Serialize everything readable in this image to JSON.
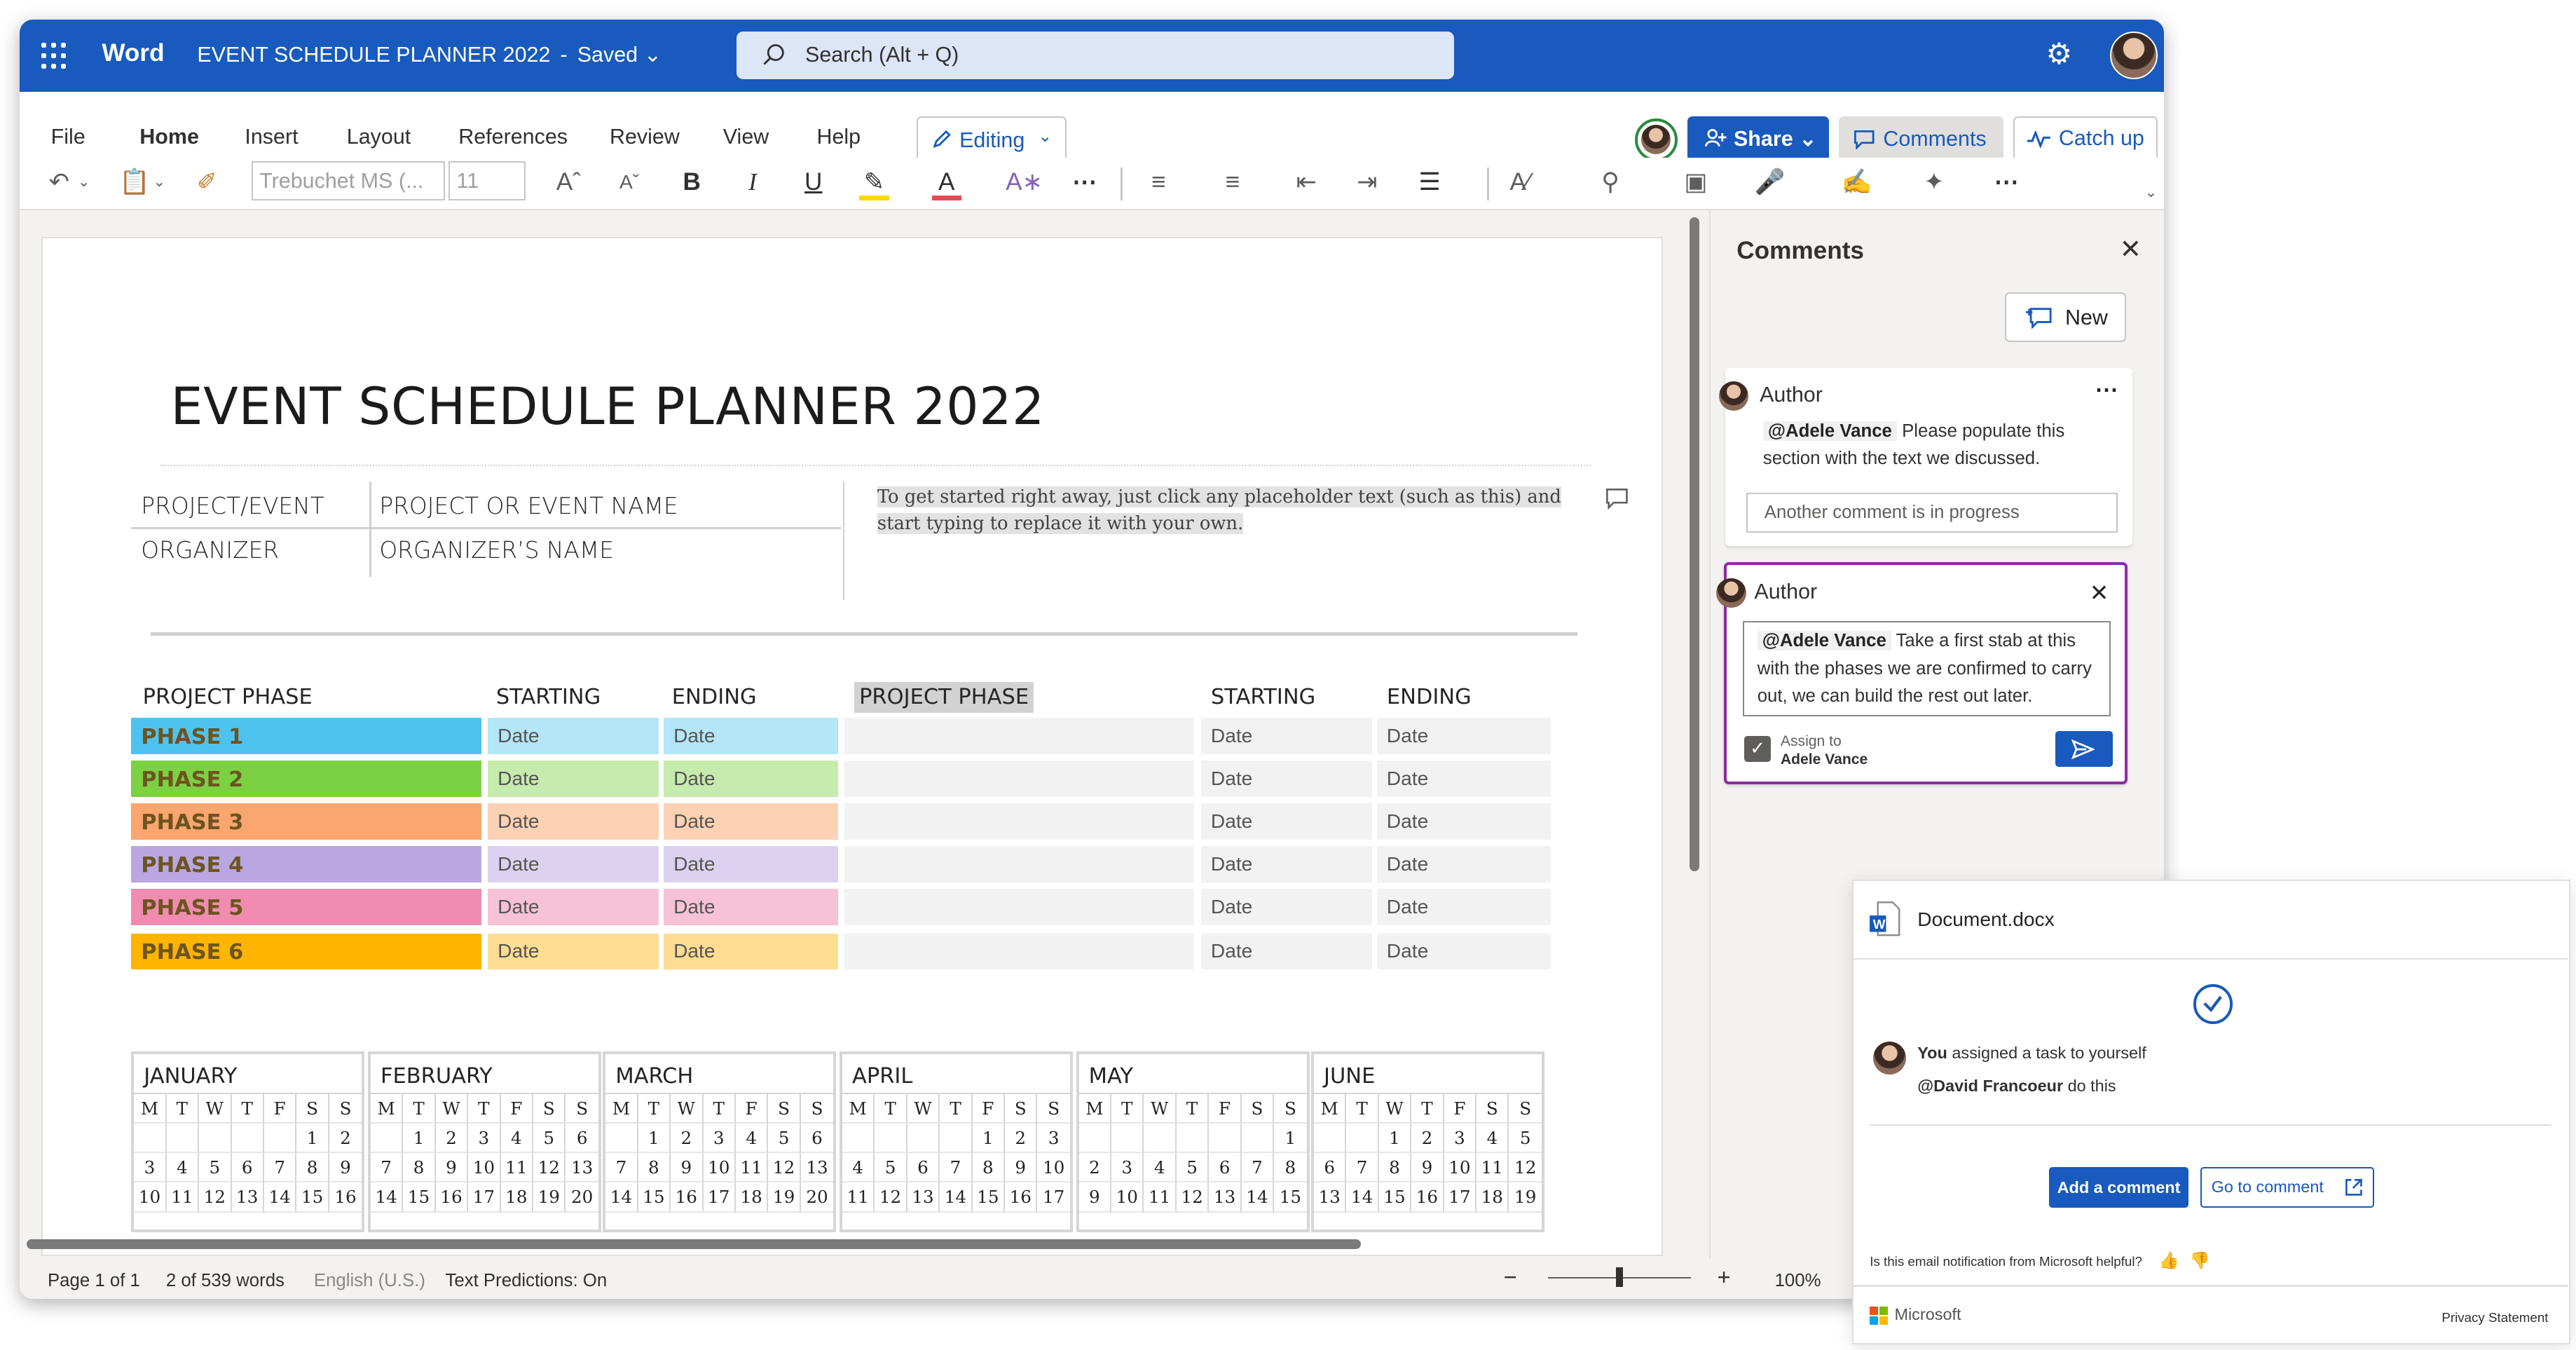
{
  "app": {
    "name": "Word",
    "doc_title": "EVENT SCHEDULE PLANNER 2022",
    "save_state": "Saved",
    "search_placeholder": "Search (Alt + Q)"
  },
  "menu": {
    "items": [
      "File",
      "Home",
      "Insert",
      "Layout",
      "References",
      "Review",
      "View",
      "Help"
    ],
    "active": "Home",
    "editing_label": "Editing",
    "share_label": "Share",
    "comments_label": "Comments",
    "catchup_label": "Catch up"
  },
  "toolbar": {
    "font": "Trebuchet MS (...",
    "size": "11"
  },
  "document": {
    "title": "EVENT SCHEDULE PLANNER 2022",
    "info": {
      "project_label": "PROJECT/EVENT",
      "project_value": "PROJECT OR EVENT NAME",
      "organizer_label": "ORGANIZER",
      "organizer_value": "ORGANIZER’S NAME"
    },
    "placeholder_text": "To get started right away, just click any placeholder text (such as this) and start typing to replace it with your own.",
    "columns": {
      "phase": "PROJECT PHASE",
      "starting": "STARTING",
      "ending": "ENDING"
    },
    "phases": [
      {
        "name": "PHASE 1",
        "color": "#4ec3ef",
        "light": "#b3e6f7"
      },
      {
        "name": "PHASE 2",
        "color": "#7bd142",
        "light": "#c6ebad"
      },
      {
        "name": "PHASE 3",
        "color": "#fba56f",
        "light": "#fdd1b3"
      },
      {
        "name": "PHASE 4",
        "color": "#b8a7e0",
        "light": "#dcd2f0"
      },
      {
        "name": "PHASE 5",
        "color": "#f08cb0",
        "light": "#f7c2d5"
      },
      {
        "name": "PHASE 6",
        "color": "#ffb400",
        "light": "#ffdd90"
      }
    ],
    "date_label": "Date",
    "weekdays": [
      "M",
      "T",
      "W",
      "T",
      "F",
      "S",
      "S"
    ],
    "months": [
      {
        "name": "JANUARY",
        "rows": [
          [
            "",
            "",
            "",
            "",
            "",
            "1",
            "2"
          ],
          [
            "3",
            "4",
            "5",
            "6",
            "7",
            "8",
            "9"
          ],
          [
            "10",
            "11",
            "12",
            "13",
            "14",
            "15",
            "16"
          ]
        ]
      },
      {
        "name": "FEBRUARY",
        "rows": [
          [
            "",
            "1",
            "2",
            "3",
            "4",
            "5",
            "6"
          ],
          [
            "7",
            "8",
            "9",
            "10",
            "11",
            "12",
            "13"
          ],
          [
            "14",
            "15",
            "16",
            "17",
            "18",
            "19",
            "20"
          ]
        ]
      },
      {
        "name": "MARCH",
        "rows": [
          [
            "",
            "1",
            "2",
            "3",
            "4",
            "5",
            "6"
          ],
          [
            "7",
            "8",
            "9",
            "10",
            "11",
            "12",
            "13"
          ],
          [
            "14",
            "15",
            "16",
            "17",
            "18",
            "19",
            "20"
          ]
        ]
      },
      {
        "name": "APRIL",
        "rows": [
          [
            "",
            "",
            "",
            "",
            "1",
            "2",
            "3"
          ],
          [
            "4",
            "5",
            "6",
            "7",
            "8",
            "9",
            "10"
          ],
          [
            "11",
            "12",
            "13",
            "14",
            "15",
            "16",
            "17"
          ]
        ]
      },
      {
        "name": "MAY",
        "rows": [
          [
            "",
            "",
            "",
            "",
            "",
            "",
            "1"
          ],
          [
            "2",
            "3",
            "4",
            "5",
            "6",
            "7",
            "8"
          ],
          [
            "9",
            "10",
            "11",
            "12",
            "13",
            "14",
            "15"
          ]
        ]
      },
      {
        "name": "JUNE",
        "rows": [
          [
            "",
            "",
            "1",
            "2",
            "3",
            "4",
            "5"
          ],
          [
            "6",
            "7",
            "8",
            "9",
            "10",
            "11",
            "12"
          ],
          [
            "13",
            "14",
            "15",
            "16",
            "17",
            "18",
            "19"
          ]
        ]
      }
    ]
  },
  "statusbar": {
    "page": "Page 1 of 1",
    "words": "2 of 539 words",
    "language": "English (U.S.)",
    "predictions": "Text Predictions: On",
    "zoom": "100%",
    "zoom_level": 1.0
  },
  "comments": {
    "title": "Comments",
    "new_label": "New",
    "thread1": {
      "author": "Author",
      "mention": "@Adele Vance",
      "text": "Please populate this section with the text we discussed.",
      "reply_placeholder": "Another comment is in progress"
    },
    "thread2": {
      "author": "Author",
      "mention": "@Adele Vance",
      "text": "Take a first stab at this with the phases we are confirmed to carry out, we can build the rest out later.",
      "assign_label": "Assign to",
      "assignee": "Adele Vance"
    }
  },
  "notification": {
    "file": "Document.docx",
    "actor": "You",
    "action": "assigned a task to yourself",
    "mention": "@David Francoeur",
    "task": "do this",
    "add_comment": "Add a comment",
    "go_to_comment": "Go to comment",
    "helpful_question": "Is this email notification from Microsoft helpful?",
    "brand": "Microsoft",
    "privacy": "Privacy Statement"
  }
}
